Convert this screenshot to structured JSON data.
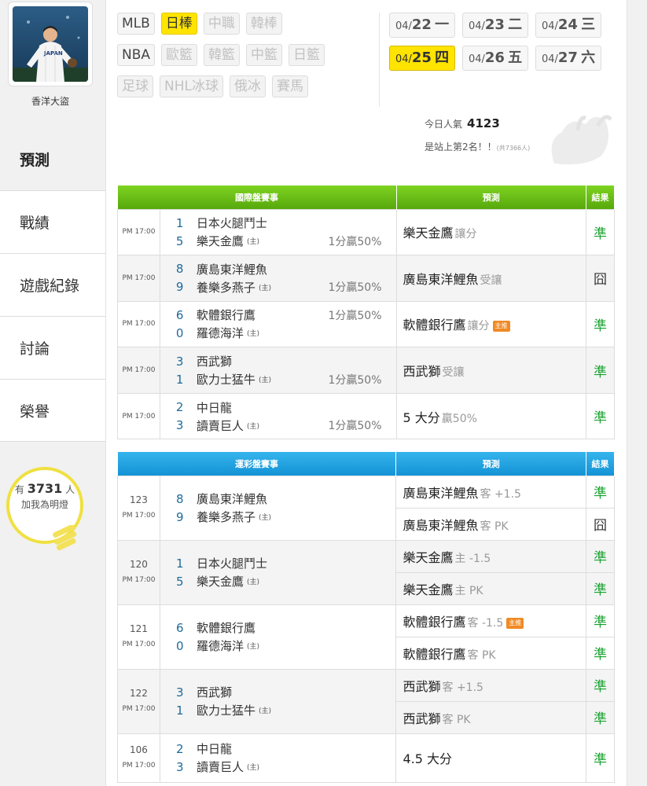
{
  "user": {
    "name": "香洋大盜"
  },
  "nav": [
    {
      "label": "預測"
    },
    {
      "label": "戰績"
    },
    {
      "label": "遊戲紀錄"
    },
    {
      "label": "討論"
    },
    {
      "label": "榮譽"
    }
  ],
  "fans": {
    "prefix": "有",
    "count": "3731",
    "suffix": "人",
    "cta": "加我為明燈"
  },
  "sports": {
    "row1": [
      "MLB",
      "日棒",
      "中職",
      "韓棒"
    ],
    "row2": [
      "NBA",
      "歐籃",
      "韓籃",
      "中籃",
      "日籃"
    ],
    "row3": [
      "足球",
      "NHL冰球",
      "俄冰",
      "賽馬"
    ]
  },
  "dates": [
    {
      "md": "04/",
      "day": "22",
      "wd": "一"
    },
    {
      "md": "04/",
      "day": "23",
      "wd": "二"
    },
    {
      "md": "04/",
      "day": "24",
      "wd": "三"
    },
    {
      "md": "04/",
      "day": "25",
      "wd": "四"
    },
    {
      "md": "04/",
      "day": "26",
      "wd": "五"
    },
    {
      "md": "04/",
      "day": "27",
      "wd": "六"
    }
  ],
  "popularity": {
    "label": "今日人氣",
    "count": "4123",
    "rank_text": "是站上第2名！！",
    "total": "(共7366人)"
  },
  "colors": {
    "win": "#18a22e",
    "intl_header": "#6cc218",
    "lottery_header": "#2aa8e6",
    "selected": "#ffe400"
  },
  "intl": {
    "headers": [
      "國際盤賽事",
      "預測",
      "結果"
    ],
    "rows": [
      {
        "time": "PM 17:00",
        "a_score": "1",
        "a_team": "日本火腿鬥士",
        "a_host": "",
        "a_odds": "",
        "b_score": "5",
        "b_team": "樂天金鷹",
        "b_host": "(主)",
        "b_odds": "1分贏50%",
        "pick": "樂天金鷹",
        "tip": "讓分",
        "badge": "",
        "result": "準"
      },
      {
        "time": "PM 17:00",
        "a_score": "8",
        "a_team": "廣島東洋鯉魚",
        "a_host": "",
        "a_odds": "",
        "b_score": "9",
        "b_team": "養樂多燕子",
        "b_host": "(主)",
        "b_odds": "1分贏50%",
        "pick": "廣島東洋鯉魚",
        "tip": "受讓",
        "badge": "",
        "result": "囧"
      },
      {
        "time": "PM 17:00",
        "a_score": "6",
        "a_team": "軟體銀行鷹",
        "a_host": "",
        "a_odds": "1分贏50%",
        "b_score": "0",
        "b_team": "羅德海洋",
        "b_host": "(主)",
        "b_odds": "",
        "pick": "軟體銀行鷹",
        "tip": "讓分",
        "badge": "主推",
        "result": "準"
      },
      {
        "time": "PM 17:00",
        "a_score": "3",
        "a_team": "西武獅",
        "a_host": "",
        "a_odds": "",
        "b_score": "1",
        "b_team": "歐力士猛牛",
        "b_host": "(主)",
        "b_odds": "1分贏50%",
        "pick": "西武獅",
        "tip": "受讓",
        "badge": "",
        "result": "準"
      },
      {
        "time": "PM 17:00",
        "a_score": "2",
        "a_team": "中日龍",
        "a_host": "",
        "a_odds": "",
        "b_score": "3",
        "b_team": "讀賣巨人",
        "b_host": "(主)",
        "b_odds": "1分贏50%",
        "pick": "5 大分",
        "tip": "贏50%",
        "badge": "",
        "result": "準"
      }
    ]
  },
  "lottery": {
    "headers": [
      "運彩盤賽事",
      "預測",
      "結果"
    ],
    "rows": [
      {
        "num": "123",
        "time": "PM 17:00",
        "a_score": "8",
        "a_team": "廣島東洋鯉魚",
        "b_score": "9",
        "b_team": "養樂多燕子",
        "b_host": "(主)",
        "picks": [
          {
            "pick": "廣島東洋鯉魚",
            "tip": "客 +1.5",
            "badge": "",
            "result": "準"
          },
          {
            "pick": "廣島東洋鯉魚",
            "tip": "客 PK",
            "badge": "",
            "result": "囧"
          }
        ]
      },
      {
        "num": "120",
        "time": "PM 17:00",
        "a_score": "1",
        "a_team": "日本火腿鬥士",
        "b_score": "5",
        "b_team": "樂天金鷹",
        "b_host": "(主)",
        "picks": [
          {
            "pick": "樂天金鷹",
            "tip": "主 -1.5",
            "badge": "",
            "result": "準"
          },
          {
            "pick": "樂天金鷹",
            "tip": "主 PK",
            "badge": "",
            "result": "準"
          }
        ]
      },
      {
        "num": "121",
        "time": "PM 17:00",
        "a_score": "6",
        "a_team": "軟體銀行鷹",
        "b_score": "0",
        "b_team": "羅德海洋",
        "b_host": "(主)",
        "picks": [
          {
            "pick": "軟體銀行鷹",
            "tip": "客 -1.5",
            "badge": "主推",
            "result": "準"
          },
          {
            "pick": "軟體銀行鷹",
            "tip": "客 PK",
            "badge": "",
            "result": "準"
          }
        ]
      },
      {
        "num": "122",
        "time": "PM 17:00",
        "a_score": "3",
        "a_team": "西武獅",
        "b_score": "1",
        "b_team": "歐力士猛牛",
        "b_host": "(主)",
        "picks": [
          {
            "pick": "西武獅",
            "tip": "客 +1.5",
            "badge": "",
            "result": "準"
          },
          {
            "pick": "西武獅",
            "tip": "客 PK",
            "badge": "",
            "result": "準"
          }
        ]
      },
      {
        "num": "106",
        "time": "PM 17:00",
        "a_score": "2",
        "a_team": "中日龍",
        "b_score": "3",
        "b_team": "讀賣巨人",
        "b_host": "(主)",
        "picks": [
          {
            "pick": "4.5 大分",
            "tip": "",
            "badge": "",
            "result": "準"
          }
        ]
      }
    ]
  }
}
